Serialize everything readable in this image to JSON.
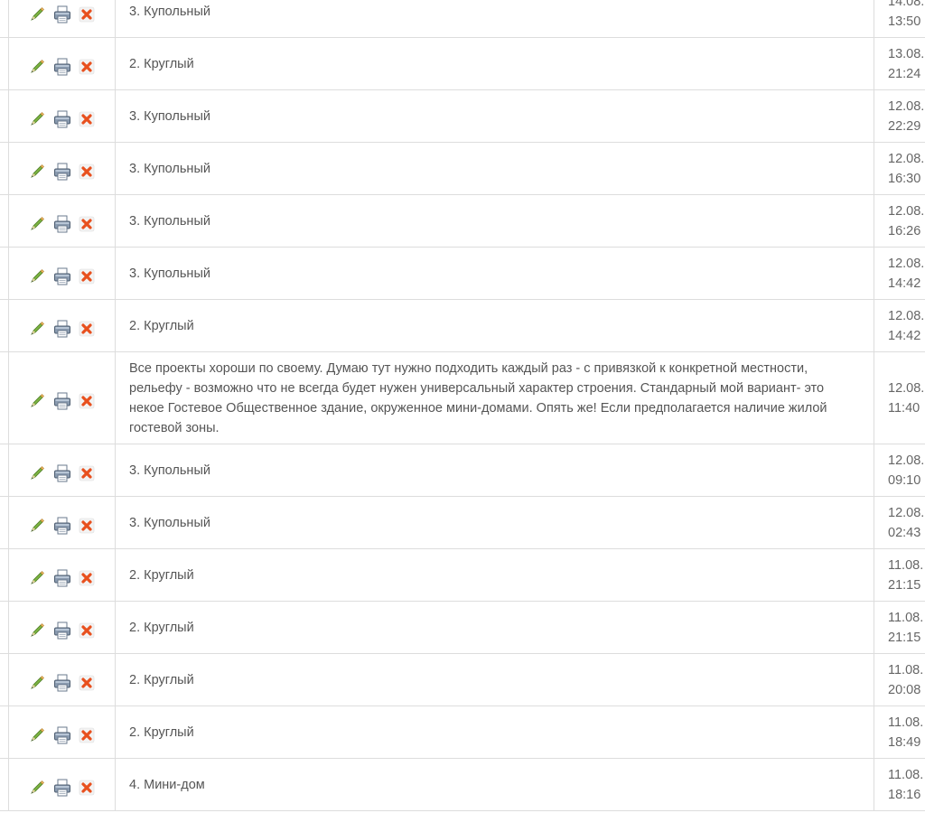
{
  "rows": [
    {
      "answer": "3. Купольный",
      "date": "14.08.",
      "time": "13:50"
    },
    {
      "answer": "2. Круглый",
      "date": "13.08.",
      "time": "21:24"
    },
    {
      "answer": "3. Купольный",
      "date": "12.08.",
      "time": "22:29"
    },
    {
      "answer": "3. Купольный",
      "date": "12.08.",
      "time": "16:30"
    },
    {
      "answer": "3. Купольный",
      "date": "12.08.",
      "time": "16:26"
    },
    {
      "answer": "3. Купольный",
      "date": "12.08.",
      "time": "14:42"
    },
    {
      "answer": "2. Круглый",
      "date": "12.08.",
      "time": "14:42"
    },
    {
      "answer": "Все проекты хороши по своему. Думаю тут нужно подходить каждый раз - с привязкой к конкретной местности, рельефу - возможно что не всегда будет нужен универсальный характер строения. Стандарный мой вариант- это некое Гостевое Общественное здание, окруженное мини-домами. Опять же! Если предполагается наличие жилой гостевой зоны.",
      "date": "12.08.",
      "time": "11:40"
    },
    {
      "answer": "3. Купольный",
      "date": "12.08.",
      "time": "09:10"
    },
    {
      "answer": "3. Купольный",
      "date": "12.08.",
      "time": "02:43"
    },
    {
      "answer": "2. Круглый",
      "date": "11.08.",
      "time": "21:15"
    },
    {
      "answer": "2. Круглый",
      "date": "11.08.",
      "time": "21:15"
    },
    {
      "answer": "2. Круглый",
      "date": "11.08.",
      "time": "20:08"
    },
    {
      "answer": "2. Круглый",
      "date": "11.08.",
      "time": "18:49"
    },
    {
      "answer": "4. Мини-дом",
      "date": "11.08.",
      "time": "18:16"
    }
  ],
  "icons": {
    "edit": "pencil-icon",
    "print": "printer-icon",
    "delete": "delete-x-icon"
  },
  "colors": {
    "border": "#dddddd",
    "text": "#555555",
    "pencil_green": "#6aa84f",
    "delete_red": "#e8501e"
  }
}
